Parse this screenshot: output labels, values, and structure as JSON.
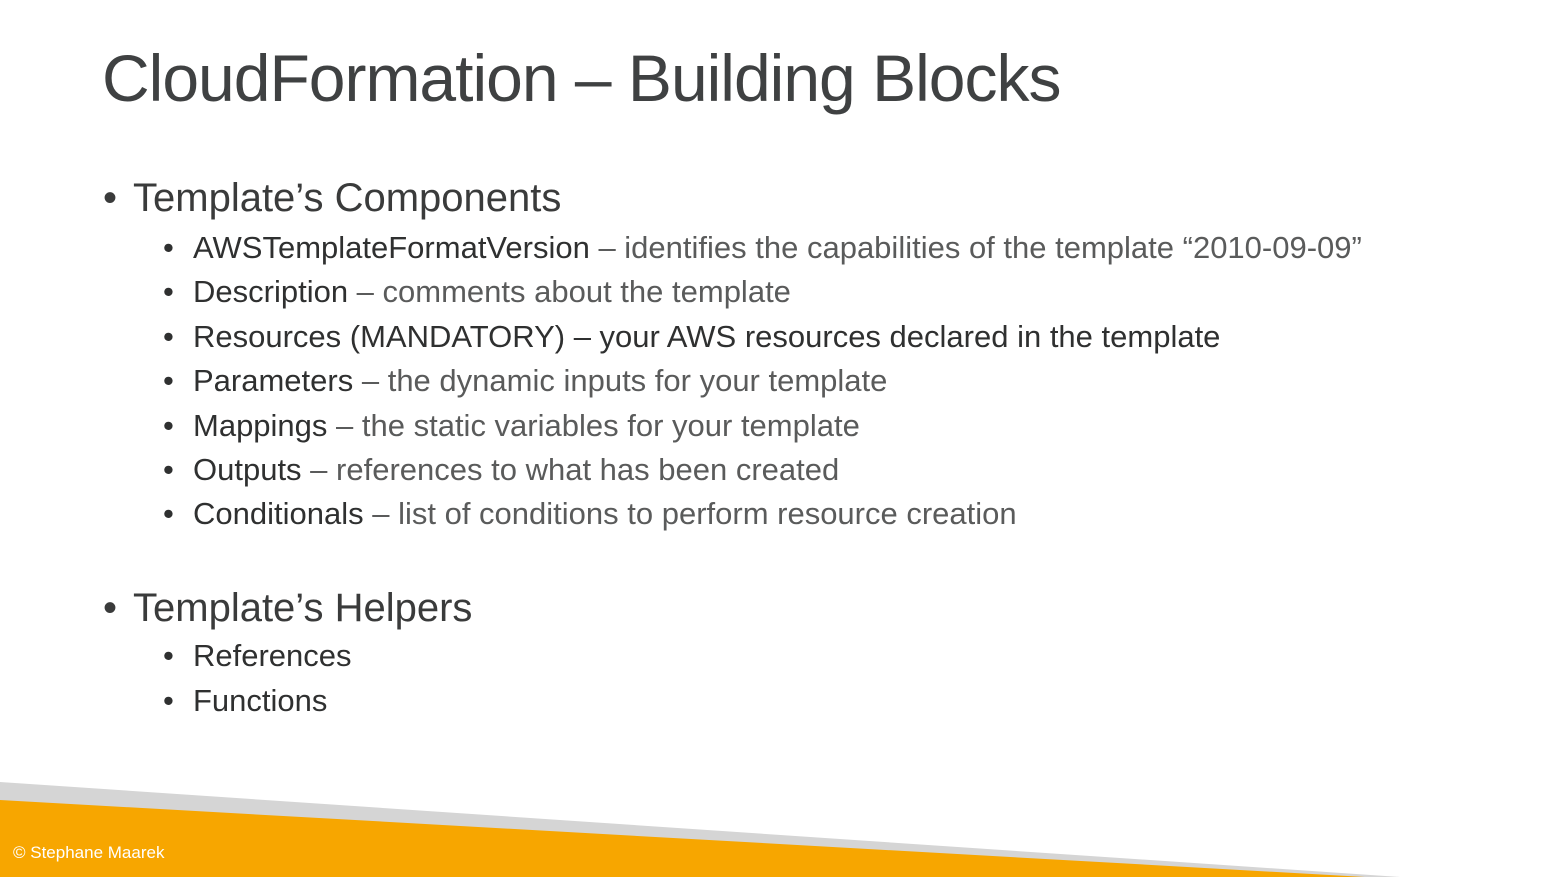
{
  "title": "CloudFormation – Building Blocks",
  "sections": [
    {
      "heading": "Template’s Components",
      "items": [
        {
          "term": "AWSTemplateFormatVersion",
          "desc": " – identifies the capabilities of the template “2010-09-09”"
        },
        {
          "term": "Description",
          "desc": " – comments about the template"
        },
        {
          "term": "Resources (MANDATORY)",
          "desc": " – your AWS resources declared in the template"
        },
        {
          "term": "Parameters",
          "desc": " – the dynamic inputs for your template"
        },
        {
          "term": "Mappings",
          "desc": " – the static variables for your template"
        },
        {
          "term": "Outputs",
          "desc": " – references to what has been created"
        },
        {
          "term": "Conditionals",
          "desc": " – list of conditions to perform resource creation"
        }
      ]
    },
    {
      "heading": "Template’s Helpers",
      "items": [
        {
          "term": "References"
        },
        {
          "term": "Functions"
        }
      ]
    }
  ],
  "footer": "© Stephane Maarek",
  "colors": {
    "accent": "#f7a600",
    "band_gray": "#d5d5d5"
  },
  "bullet": "•"
}
